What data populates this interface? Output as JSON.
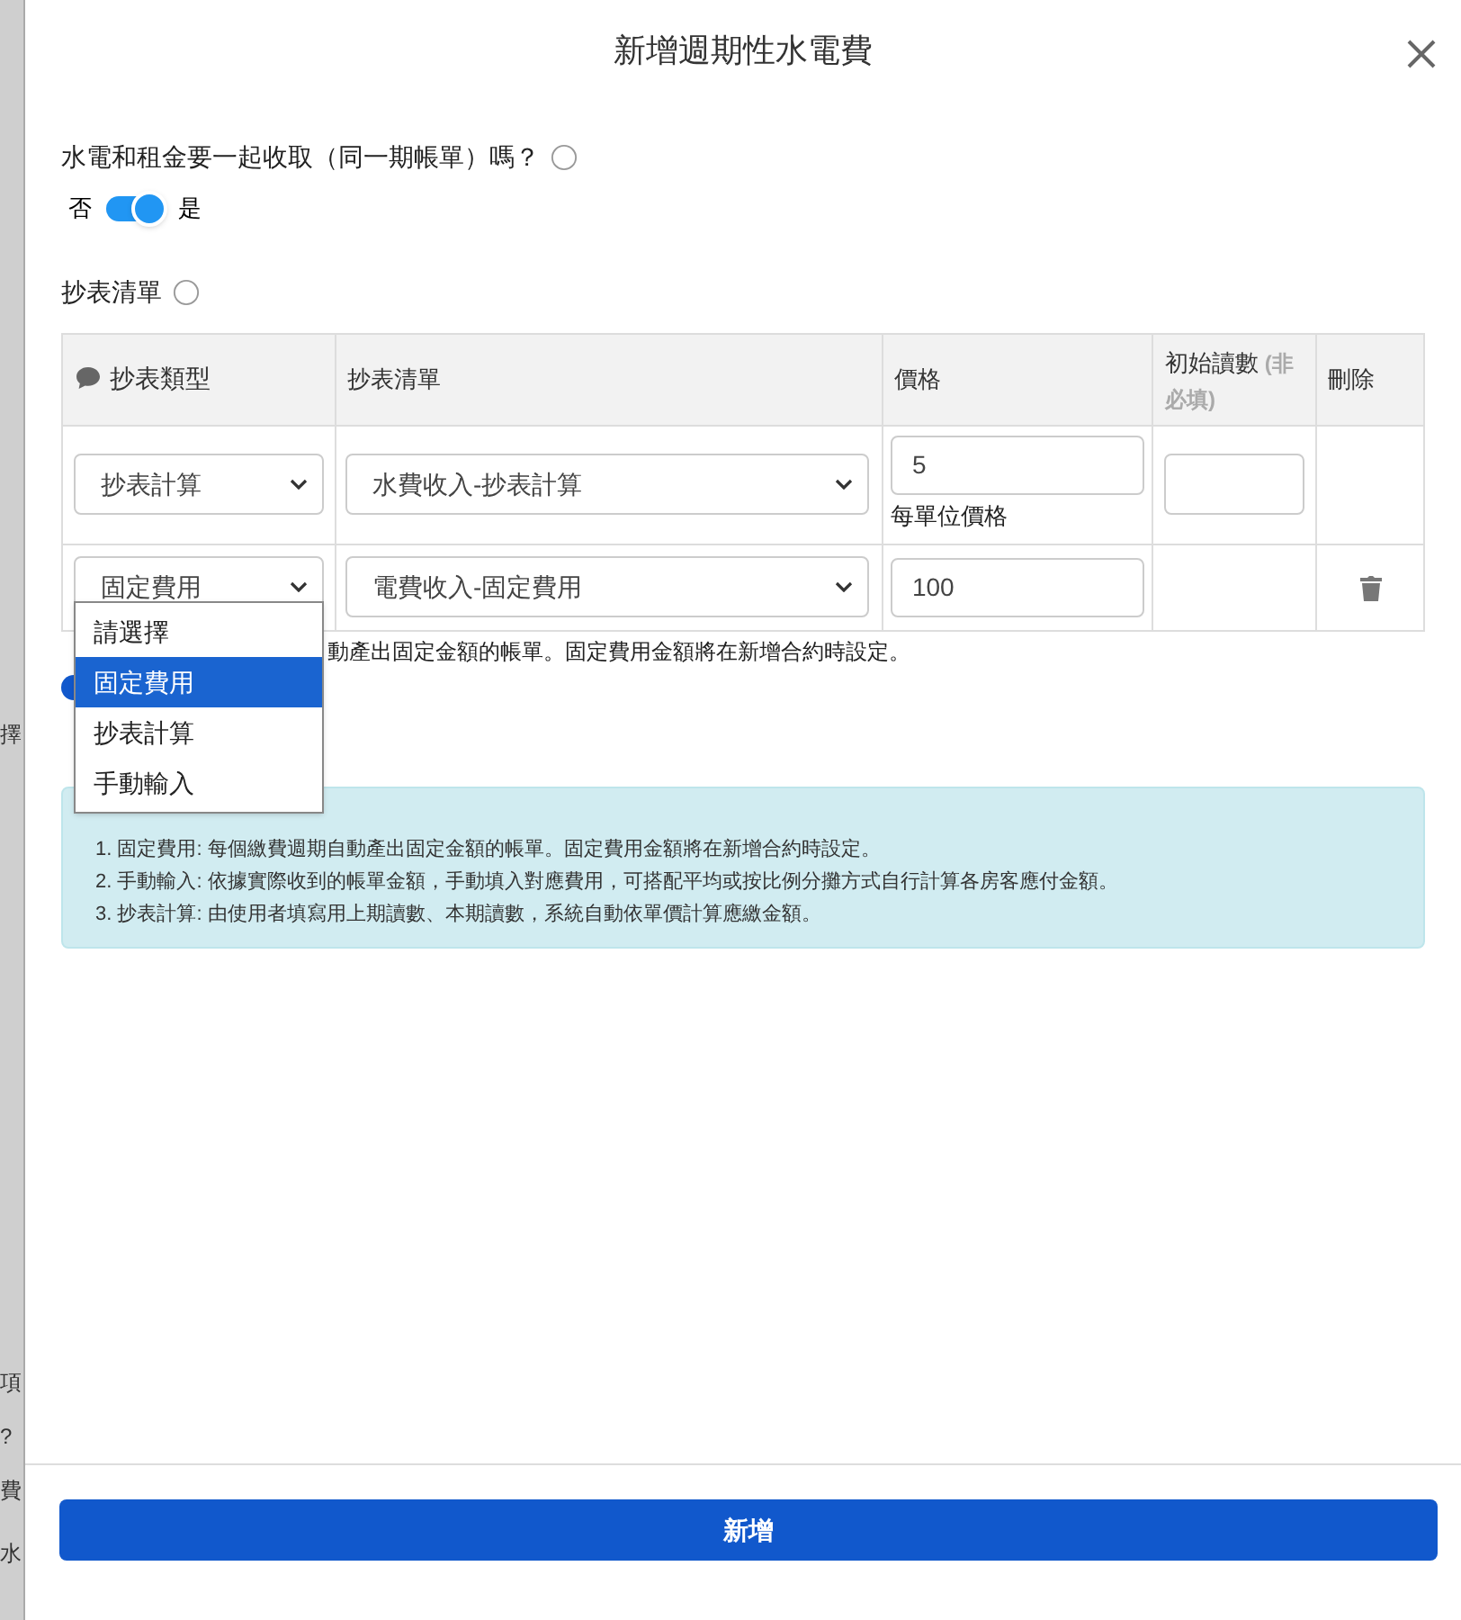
{
  "backdrop": {
    "fragments": [
      "擇",
      "項",
      "?",
      "費",
      "水"
    ]
  },
  "modal": {
    "title": "新增週期性水電費"
  },
  "combine_question": {
    "label": "水電和租金要一起收取（同一期帳單）嗎？",
    "off_label": "否",
    "on_label": "是",
    "on": true
  },
  "meter_list": {
    "label": "抄表清單",
    "columns": [
      {
        "label": "抄表類型",
        "kind": "icon"
      },
      {
        "label": "抄表清單",
        "kind": "text"
      },
      {
        "label": "價格",
        "kind": "text"
      },
      {
        "label": "初始讀數",
        "note": "(非必填)",
        "kind": "text"
      },
      {
        "label": "刪除",
        "kind": "text"
      }
    ],
    "rows": [
      {
        "type": "抄表計算",
        "item": "水費收入-抄表計算",
        "price": "5",
        "price_note": "每單位價格",
        "initial_reading_field": true,
        "deletable": false
      },
      {
        "type": "固定費用",
        "item": "電費收入-固定費用",
        "price": "100",
        "initial_reading_field": false,
        "deletable": true
      }
    ],
    "row_hint": "動產出固定金額的帳單。固定費用金額將在新增合約時設定。"
  },
  "type_dropdown": {
    "options": [
      {
        "label": "請選擇",
        "selected": false
      },
      {
        "label": "固定費用",
        "selected": true
      },
      {
        "label": "抄表計算",
        "selected": false
      },
      {
        "label": "手動輸入",
        "selected": false
      }
    ]
  },
  "info": {
    "lines": [
      "1. 固定費用: 每個繳費週期自動產出固定金額的帳單。固定費用金額將在新增合約時設定。",
      "2. 手動輸入: 依據實際收到的帳單金額，手動填入對應費用，可搭配平均或按比例分攤方式自行計算各房客應付金額。",
      "3. 抄表計算: 由使用者填寫用上期讀數、本期讀數，系統自動依單價計算應繳金額。"
    ]
  },
  "submit": {
    "label": "新增"
  }
}
